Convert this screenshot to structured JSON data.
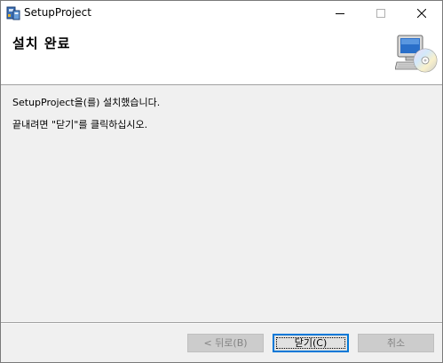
{
  "window": {
    "title": "SetupProject",
    "icon": "setup-installer-icon",
    "controls": {
      "minimize": "minimize-icon",
      "maximize": "maximize-icon",
      "close": "close-icon"
    }
  },
  "header": {
    "title": "설치 완료",
    "icon": "computer-cd-icon"
  },
  "body": {
    "line1": "SetupProject을(를) 설치했습니다.",
    "line2": "끝내려면 \"닫기\"를 클릭하십시오."
  },
  "buttons": {
    "back_label": "< 뒤로(B)",
    "close_label": "닫기(C)",
    "cancel_label": "취소",
    "back_enabled": false,
    "close_enabled": true,
    "cancel_enabled": false
  },
  "colors": {
    "accent": "#0078d7",
    "window_bg": "#f0f0f0",
    "header_bg": "#ffffff",
    "disabled_text": "#838383"
  }
}
